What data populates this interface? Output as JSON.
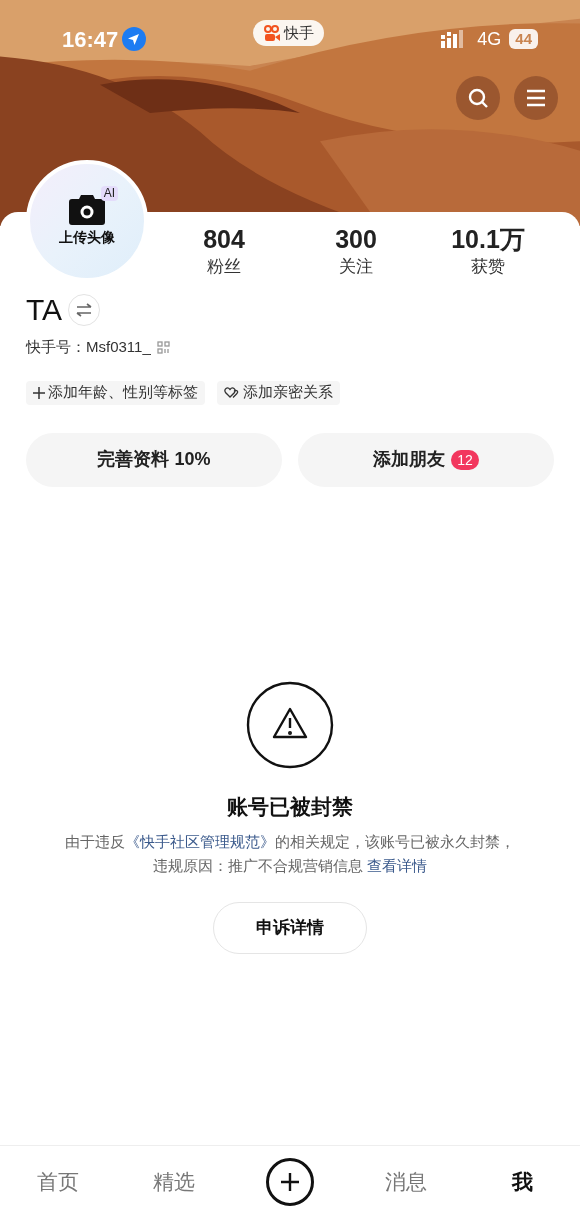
{
  "status_bar": {
    "time": "16:47",
    "app_badge": "快手",
    "network": "4G",
    "battery": "44"
  },
  "avatar": {
    "ai_badge": "AI",
    "label": "上传头像"
  },
  "stats": [
    {
      "value": "804",
      "label": "粉丝"
    },
    {
      "value": "300",
      "label": "关注"
    },
    {
      "value": "10.1万",
      "label": "获赞"
    }
  ],
  "profile": {
    "name": "TA",
    "id": "快手号：Msf0311_"
  },
  "tags": [
    {
      "kind": "plus",
      "label": "添加年龄、性别等标签"
    },
    {
      "kind": "hearts",
      "label": "添加亲密关系"
    }
  ],
  "actions": [
    {
      "label": "完善资料 10%"
    },
    {
      "label": "添加朋友",
      "badge": "12"
    }
  ],
  "notice": {
    "title": "账号已被封禁",
    "text_before": "由于违反",
    "link": "《快手社区管理规范》",
    "text_after": "的相关规定，该账号已被永久封禁，违规原因：推广不合规营销信息 ",
    "detail_link": "查看详情",
    "button": "申诉详情"
  },
  "bottom_nav": [
    {
      "kind": "tab",
      "label": "首页",
      "selected": false
    },
    {
      "kind": "tab",
      "label": "精选",
      "selected": false
    },
    {
      "kind": "create",
      "selected": false
    },
    {
      "kind": "tab",
      "label": "消息",
      "selected": false
    },
    {
      "kind": "tab",
      "label": "我",
      "selected": true
    }
  ]
}
